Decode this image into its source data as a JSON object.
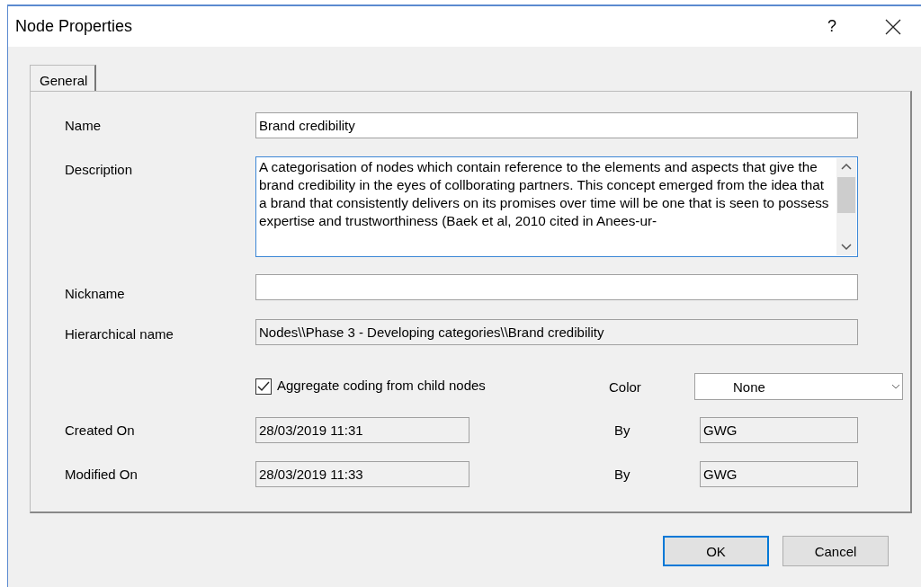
{
  "window": {
    "title": "Node Properties",
    "help": "?"
  },
  "tabs": [
    {
      "label": "General",
      "selected": true
    }
  ],
  "form": {
    "name": {
      "label": "Name",
      "value": "Brand credibility"
    },
    "description": {
      "label": "Description",
      "value": "A categorisation of nodes which contain reference to the elements and aspects that give the brand credibility in the eyes of collborating partners. This concept emerged from the idea that a brand that consistently delivers on its promises over time will be one that is seen to possess expertise and trustworthiness (Baek et al, 2010 cited in Anees-ur-"
    },
    "nickname": {
      "label": "Nickname"
    },
    "hierarchical_name": {
      "label": "Hierarchical name",
      "value": "Nodes\\\\Phase 3 - Developing categories\\\\Brand credibility"
    },
    "aggregate": {
      "label": "Aggregate coding from child nodes",
      "checked": true
    },
    "color": {
      "label": "Color",
      "value": "None"
    },
    "created": {
      "label": "Created On",
      "value": "28/03/2019 11:31",
      "by_label": "By",
      "by": "GWG"
    },
    "modified": {
      "label": "Modified On",
      "value": "28/03/2019 11:33",
      "by_label": "By",
      "by": "GWG"
    }
  },
  "buttons": [
    {
      "label": "OK",
      "default": true
    },
    {
      "label": "Cancel",
      "default": false
    }
  ]
}
